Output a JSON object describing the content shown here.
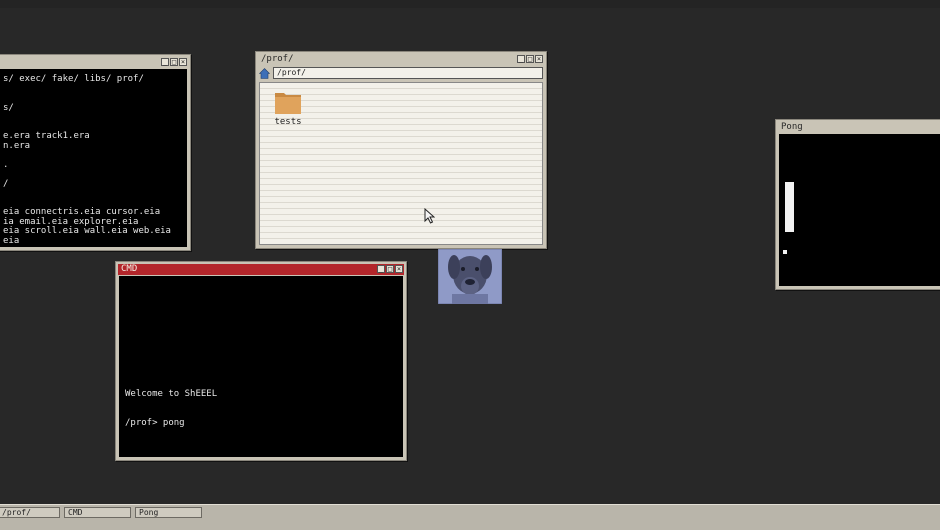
{
  "terminal_window": {
    "lines": [
      "s/ exec/ fake/ libs/ prof/",
      "",
      "",
      "s/",
      "",
      "",
      "e.era track1.era",
      "n.era",
      "",
      ".",
      "",
      "/",
      "",
      "",
      "eia connectris.eia cursor.eia",
      "ia email.eia explorer.eia",
      "eia scroll.eia wall.eia web.eia",
      "eia"
    ]
  },
  "explorer": {
    "title": "/prof/",
    "address": "/prof/",
    "items": [
      {
        "label": "tests",
        "icon": "folder-icon"
      }
    ]
  },
  "cmd": {
    "title": "CMD",
    "line1": "Welcome to ShEEEL",
    "line2": "/prof> pong"
  },
  "pong": {
    "title": "Pong"
  },
  "taskbar": {
    "items": [
      {
        "label": "/prof/"
      },
      {
        "label": "CMD"
      },
      {
        "label": "Pong"
      }
    ]
  },
  "icons": {
    "minimize": "minimize-icon",
    "maximize": "maximize-icon",
    "close": "close-icon",
    "home": "home-icon",
    "folder": "folder-icon",
    "cursor": "mouse-cursor-icon"
  },
  "colors": {
    "desktop": "#282828",
    "window_frame": "#c9c4b6",
    "cmd_titlebar": "#b3262b",
    "folder": "#d99a52"
  }
}
